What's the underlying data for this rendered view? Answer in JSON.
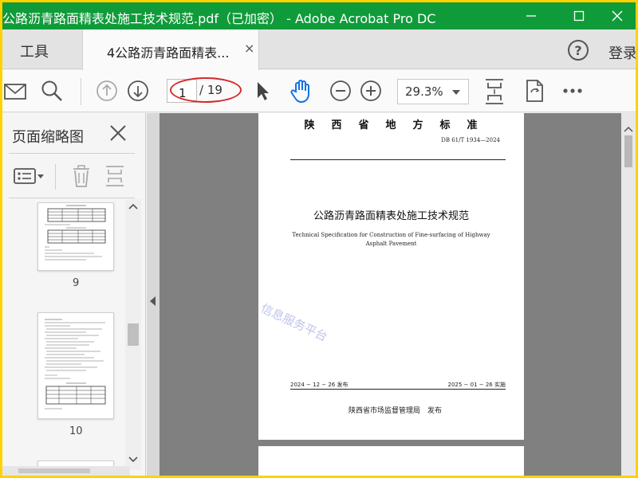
{
  "window": {
    "title": "公路沥青路面精表处施工技术规范.pdf（已加密） - Adobe Acrobat Pro DC",
    "title_bar_color": "#109b3a",
    "controls": [
      "minimize-icon",
      "maximize-icon",
      "close-icon"
    ]
  },
  "tabs": {
    "tools_label": "工具",
    "document_tab_label": "4公路沥青路面精表...",
    "close_glyph": "×",
    "help_glyph": "?",
    "login_label": "登录"
  },
  "toolbar": {
    "icons": [
      "email-icon",
      "search-icon",
      "prev-page-icon",
      "next-page-icon",
      "select-arrow-icon",
      "hand-tool-icon",
      "zoom-out-icon",
      "zoom-in-icon",
      "fit-page-icon",
      "rotate-view-icon",
      "more-icon"
    ],
    "current_page": "1",
    "total_pages": "/ 19",
    "zoom": "29.3%",
    "highlight_color": "#d42a2a"
  },
  "sidebar": {
    "title": "页面缩略图",
    "thumbnails": [
      {
        "label": "9"
      },
      {
        "label": "10"
      }
    ]
  },
  "document": {
    "page1": {
      "header": "陕西省地方标准",
      "code": "DB 61/T 1934—2024",
      "title": "公路沥青路面精表处施工技术规范",
      "title_en": "Technical Specification for Construction of Fine-surfacing of Highway Asphalt Pavement",
      "watermark": "信息服务平台",
      "publish_date": "2024 − 12 − 26 发布",
      "effective_date": "2025 − 01 − 26 实施",
      "issuer": "陕西省市场监督管理局　发布"
    }
  }
}
